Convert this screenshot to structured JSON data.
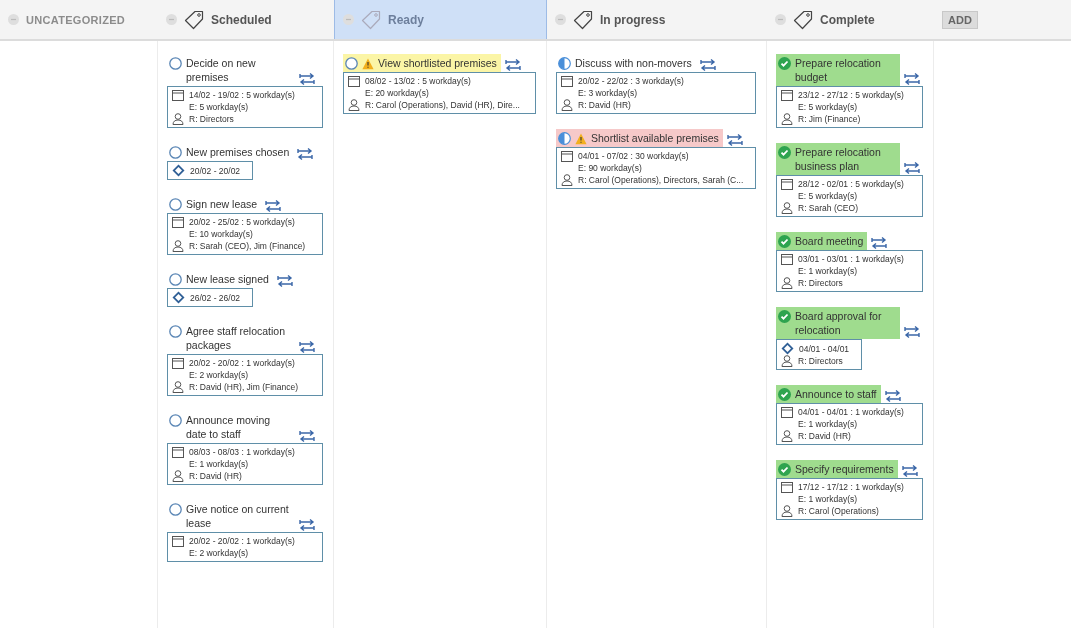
{
  "columns": [
    {
      "label": "UNCATEGORIZED",
      "kind": "uncategorized",
      "selected": false
    },
    {
      "label": "Scheduled",
      "kind": "tag",
      "selected": false,
      "cards": [
        {
          "title": "Decide on new premises",
          "kind": "not_started",
          "warning": false,
          "details": {
            "kind": "task",
            "dates": "14/02 - 19/02 : 5 workday(s)",
            "effort": "E: 5 workday(s)",
            "resources": "R: Directors"
          }
        },
        {
          "title": "New premises chosen",
          "kind": "not_started",
          "warning": false,
          "details": {
            "kind": "milestone",
            "dates": "20/02 - 20/02"
          }
        },
        {
          "title": "Sign new lease",
          "kind": "not_started",
          "warning": false,
          "details": {
            "kind": "task",
            "dates": "20/02 - 25/02 : 5 workday(s)",
            "effort": "E: 10 workday(s)",
            "resources": "R: Sarah (CEO), Jim (Finance)"
          }
        },
        {
          "title": "New lease signed",
          "kind": "not_started",
          "warning": false,
          "details": {
            "kind": "milestone",
            "dates": "26/02 - 26/02"
          }
        },
        {
          "title": "Agree staff relocation packages",
          "kind": "not_started",
          "warning": false,
          "details": {
            "kind": "task",
            "dates": "20/02 - 20/02 : 1 workday(s)",
            "effort": "E: 2 workday(s)",
            "resources": "R: David (HR), Jim (Finance)"
          }
        },
        {
          "title": "Announce moving date to staff",
          "kind": "not_started",
          "warning": false,
          "details": {
            "kind": "task",
            "dates": "08/03 - 08/03 : 1 workday(s)",
            "effort": "E: 1 workday(s)",
            "resources": "R: David (HR)"
          }
        },
        {
          "title": "Give notice on current lease",
          "kind": "not_started",
          "warning": false,
          "details": {
            "kind": "task",
            "dates": "20/02 - 20/02 : 1 workday(s)",
            "effort": "E: 2 workday(s)"
          }
        }
      ]
    },
    {
      "label": "Ready",
      "kind": "tag",
      "selected": true,
      "cards": [
        {
          "title": "View shortlisted premises",
          "kind": "not_started",
          "warning": true,
          "color": "#fbf5a6",
          "details": {
            "kind": "task",
            "dates": "08/02 - 13/02 : 5 workday(s)",
            "effort": "E: 20 workday(s)",
            "resources": "R: Carol (Operations), David (HR), Dire..."
          }
        }
      ]
    },
    {
      "label": "In progress",
      "kind": "tag",
      "selected": false,
      "cards": [
        {
          "title": "Discuss with non-movers",
          "kind": "in_progress",
          "warning": false,
          "details": {
            "kind": "task",
            "dates": "20/02 - 22/02 : 3 workday(s)",
            "effort": "E: 3 workday(s)",
            "resources": "R: David (HR)"
          }
        },
        {
          "title": "Shortlist available premises",
          "kind": "in_progress",
          "warning": true,
          "color": "#f6c9c9",
          "details": {
            "kind": "task",
            "dates": "04/01 - 07/02 : 30 workday(s)",
            "effort": "E: 90 workday(s)",
            "resources": "R: Carol (Operations), Directors, Sarah (C..."
          }
        }
      ]
    },
    {
      "label": "Complete",
      "kind": "tag",
      "selected": false,
      "cards": [
        {
          "title": "Prepare relocation budget",
          "kind": "complete",
          "warning": false,
          "color": "#9fdc8e",
          "details": {
            "kind": "task",
            "dates": "23/12 - 27/12 : 5 workday(s)",
            "effort": "E: 5 workday(s)",
            "resources": "R: Jim (Finance)"
          }
        },
        {
          "title": "Prepare relocation business plan",
          "kind": "complete",
          "warning": false,
          "color": "#9fdc8e",
          "details": {
            "kind": "task",
            "dates": "28/12 - 02/01 : 5 workday(s)",
            "effort": "E: 5 workday(s)",
            "resources": "R: Sarah (CEO)"
          }
        },
        {
          "title": "Board meeting",
          "kind": "complete",
          "warning": false,
          "color": "#9fdc8e",
          "details": {
            "kind": "task",
            "dates": "03/01 - 03/01 : 1 workday(s)",
            "effort": "E: 1 workday(s)",
            "resources": "R: Directors"
          }
        },
        {
          "title": "Board approval for relocation",
          "kind": "complete",
          "warning": false,
          "color": "#9fdc8e",
          "details": {
            "kind": "milestone",
            "dates": "04/01 - 04/01",
            "resources": "R: Directors"
          }
        },
        {
          "title": "Announce to staff",
          "kind": "complete",
          "warning": false,
          "color": "#9fdc8e",
          "details": {
            "kind": "task",
            "dates": "04/01 - 04/01 : 1 workday(s)",
            "effort": "E: 1 workday(s)",
            "resources": "R: David (HR)"
          }
        },
        {
          "title": "Specify requirements",
          "kind": "complete",
          "warning": false,
          "color": "#9fdc8e",
          "details": {
            "kind": "task",
            "dates": "17/12 - 17/12 : 1 workday(s)",
            "effort": "E: 1 workday(s)",
            "resources": "R: Carol (Operations)"
          }
        }
      ]
    }
  ],
  "add_button": "ADD"
}
